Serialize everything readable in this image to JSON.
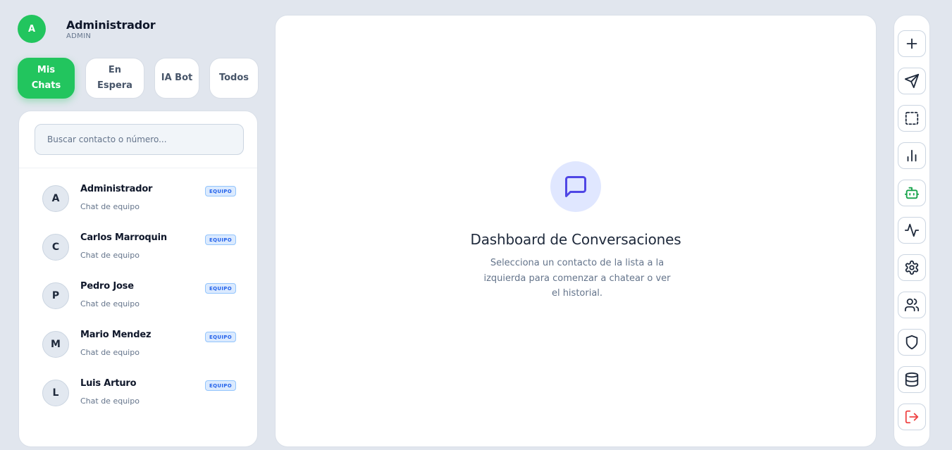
{
  "user": {
    "avatar_initial": "A",
    "name": "Administrador",
    "role": "ADMIN"
  },
  "filter_tabs": [
    {
      "label": "Mis Chats",
      "active": true
    },
    {
      "label": "En Espera",
      "active": false
    },
    {
      "label": "IA Bot",
      "active": false
    },
    {
      "label": "Todos",
      "active": false
    }
  ],
  "search": {
    "placeholder": "Buscar contacto o número...",
    "value": ""
  },
  "contacts": [
    {
      "initial": "A",
      "name": "Administrador",
      "subtitle": "Chat de equipo",
      "badge": "EQUIPO"
    },
    {
      "initial": "C",
      "name": "Carlos Marroquin",
      "subtitle": "Chat de equipo",
      "badge": "EQUIPO"
    },
    {
      "initial": "P",
      "name": "Pedro Jose",
      "subtitle": "Chat de equipo",
      "badge": "EQUIPO"
    },
    {
      "initial": "M",
      "name": "Mario Mendez",
      "subtitle": "Chat de equipo",
      "badge": "EQUIPO"
    },
    {
      "initial": "L",
      "name": "Luis Arturo",
      "subtitle": "Chat de equipo",
      "badge": "EQUIPO"
    }
  ],
  "main": {
    "icon": "message-square-icon",
    "title": "Dashboard de Conversaciones",
    "description": "Selecciona un contacto de la lista a la izquierda para comenzar a chatear o ver el historial."
  },
  "toolbar": [
    {
      "icon": "plus-icon"
    },
    {
      "icon": "send-icon"
    },
    {
      "icon": "selection-icon"
    },
    {
      "icon": "bar-chart-icon"
    },
    {
      "icon": "bot-icon"
    },
    {
      "icon": "activity-icon"
    },
    {
      "icon": "settings-icon"
    },
    {
      "icon": "users-icon"
    },
    {
      "icon": "shield-icon"
    },
    {
      "icon": "database-icon"
    },
    {
      "icon": "logout-icon"
    }
  ],
  "colors": {
    "background": "#e1e6ee",
    "accent_green": "#22c55e",
    "badge_blue": "#2563eb",
    "icon_indigo": "#4f46e5",
    "logout_red": "#ef4444"
  }
}
